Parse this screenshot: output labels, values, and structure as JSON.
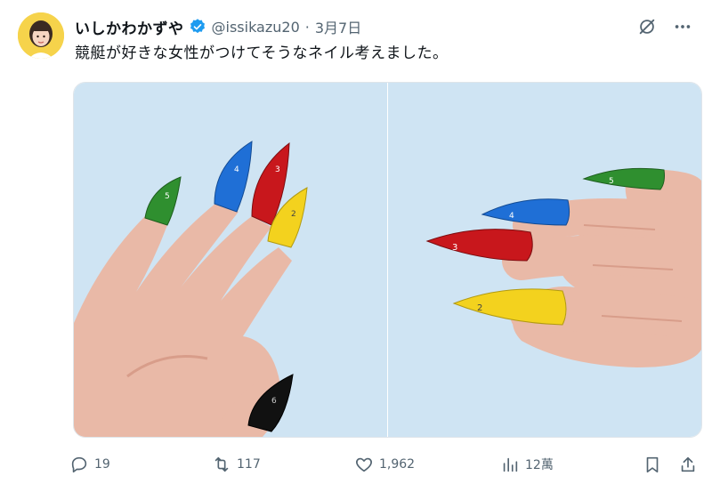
{
  "user": {
    "display_name": "いしかわかずや",
    "handle": "@issikazu20",
    "separator": "·",
    "date": "3月7日"
  },
  "tweet": {
    "text": "競艇が好きな女性がつけてそうなネイル考えました。"
  },
  "media": {
    "background_color": "#cfe4f3",
    "nail_colors": [
      "#2f8f2f",
      "#1f6fd6",
      "#c8171c",
      "#f3d21e",
      "#111111"
    ],
    "boat_numbers": [
      "5",
      "4",
      "3",
      "2",
      "6"
    ]
  },
  "actions": {
    "replies": "19",
    "reposts": "117",
    "likes": "1,962",
    "views": "12萬"
  },
  "colors": {
    "text_primary": "#0f1419",
    "text_secondary": "#536471",
    "verified_blue": "#1d9bf0"
  }
}
